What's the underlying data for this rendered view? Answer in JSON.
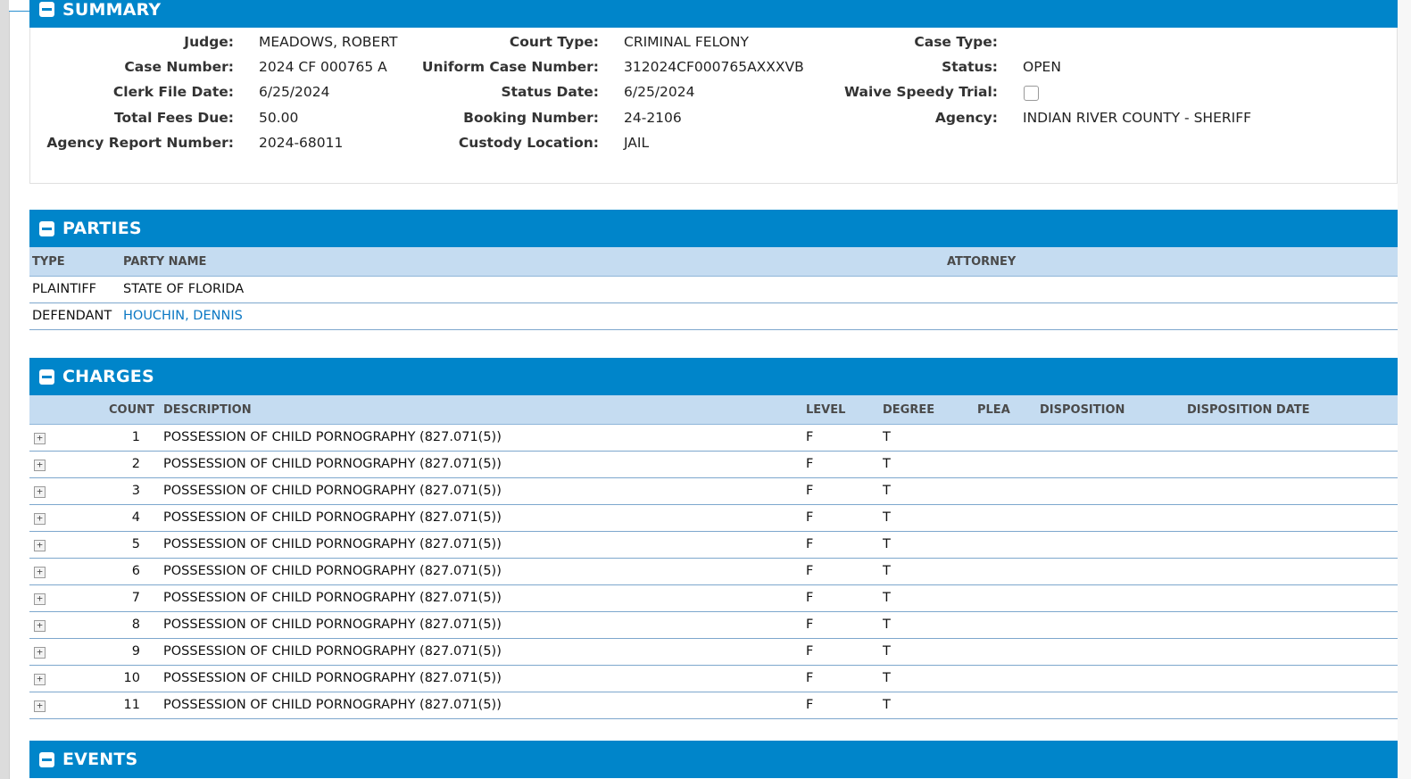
{
  "summary": {
    "title": "SUMMARY",
    "fields": {
      "judge_label": "Judge:",
      "judge": "MEADOWS, ROBERT",
      "court_type_label": "Court Type:",
      "court_type": "CRIMINAL FELONY",
      "case_type_label": "Case Type:",
      "case_type": "",
      "case_number_label": "Case Number:",
      "case_number": "2024 CF 000765 A",
      "uniform_case_number_label": "Uniform Case Number:",
      "uniform_case_number": "312024CF000765AXXXVB",
      "status_label": "Status:",
      "status": "OPEN",
      "clerk_file_date_label": "Clerk File Date:",
      "clerk_file_date": "6/25/2024",
      "status_date_label": "Status Date:",
      "status_date": "6/25/2024",
      "waive_speedy_trial_label": "Waive Speedy Trial:",
      "waive_speedy_trial": false,
      "total_fees_due_label": "Total Fees Due:",
      "total_fees_due": "50.00",
      "booking_number_label": "Booking Number:",
      "booking_number": "24-2106",
      "agency_label": "Agency:",
      "agency": "INDIAN RIVER COUNTY - SHERIFF",
      "agency_report_number_label": "Agency Report Number:",
      "agency_report_number": "2024-68011",
      "custody_location_label": "Custody Location:",
      "custody_location": "JAIL"
    }
  },
  "parties": {
    "title": "PARTIES",
    "columns": {
      "type": "TYPE",
      "party_name": "PARTY NAME",
      "attorney": "ATTORNEY"
    },
    "rows": [
      {
        "type": "PLAINTIFF",
        "party_name": "STATE OF FLORIDA",
        "attorney": ""
      },
      {
        "type": "DEFENDANT",
        "party_name": "HOUCHIN, DENNIS",
        "attorney": ""
      }
    ]
  },
  "charges": {
    "title": "CHARGES",
    "columns": {
      "count": "COUNT",
      "description": "DESCRIPTION",
      "level": "LEVEL",
      "degree": "DEGREE",
      "plea": "PLEA",
      "disposition": "DISPOSITION",
      "disposition_date": "DISPOSITION DATE"
    },
    "expand_glyph": "+",
    "rows": [
      {
        "count": "1",
        "description": "POSSESSION OF CHILD PORNOGRAPHY (827.071(5))",
        "level": "F",
        "degree": "T"
      },
      {
        "count": "2",
        "description": "POSSESSION OF CHILD PORNOGRAPHY (827.071(5))",
        "level": "F",
        "degree": "T"
      },
      {
        "count": "3",
        "description": "POSSESSION OF CHILD PORNOGRAPHY (827.071(5))",
        "level": "F",
        "degree": "T"
      },
      {
        "count": "4",
        "description": "POSSESSION OF CHILD PORNOGRAPHY (827.071(5))",
        "level": "F",
        "degree": "T"
      },
      {
        "count": "5",
        "description": "POSSESSION OF CHILD PORNOGRAPHY (827.071(5))",
        "level": "F",
        "degree": "T"
      },
      {
        "count": "6",
        "description": "POSSESSION OF CHILD PORNOGRAPHY (827.071(5))",
        "level": "F",
        "degree": "T"
      },
      {
        "count": "7",
        "description": "POSSESSION OF CHILD PORNOGRAPHY (827.071(5))",
        "level": "F",
        "degree": "T"
      },
      {
        "count": "8",
        "description": "POSSESSION OF CHILD PORNOGRAPHY (827.071(5))",
        "level": "F",
        "degree": "T"
      },
      {
        "count": "9",
        "description": "POSSESSION OF CHILD PORNOGRAPHY (827.071(5))",
        "level": "F",
        "degree": "T"
      },
      {
        "count": "10",
        "description": "POSSESSION OF CHILD PORNOGRAPHY (827.071(5))",
        "level": "F",
        "degree": "T"
      },
      {
        "count": "11",
        "description": "POSSESSION OF CHILD PORNOGRAPHY (827.071(5))",
        "level": "F",
        "degree": "T"
      }
    ]
  },
  "events": {
    "title": "EVENTS"
  },
  "colors": {
    "header_blue": "#0085ca",
    "grid_head": "#c5dcf1",
    "link": "#0b78c4"
  }
}
